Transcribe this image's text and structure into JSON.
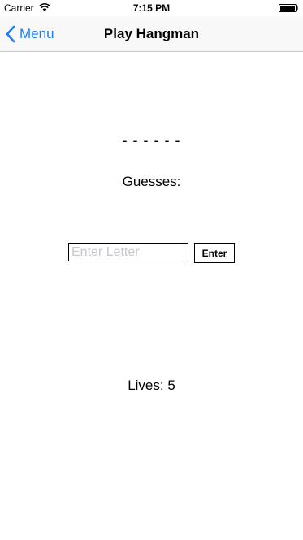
{
  "status_bar": {
    "carrier": "Carrier",
    "time": "7:15 PM",
    "wifi_icon": "wifi-icon",
    "battery_icon": "battery-icon"
  },
  "nav": {
    "back_label": "Menu",
    "back_icon": "chevron-left-icon",
    "title": "Play Hangman"
  },
  "game": {
    "word_display": "- - - - - -",
    "guesses_label": "Guesses:",
    "input_placeholder": "Enter Letter",
    "input_value": "",
    "enter_label": "Enter",
    "lives_label": "Lives: 5"
  },
  "colors": {
    "accent": "#1d7cf2",
    "nav_background": "#f8f8f8",
    "placeholder": "#c7c7cd"
  }
}
